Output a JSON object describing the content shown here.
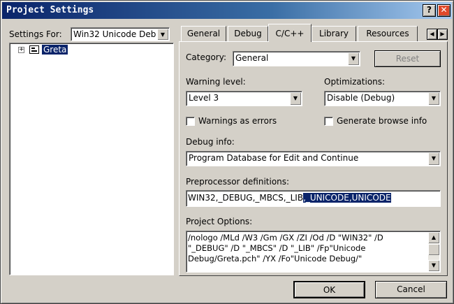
{
  "window": {
    "title": "Project Settings",
    "help_glyph": "?",
    "close_glyph": "✕"
  },
  "left": {
    "settings_for_label": "Settings For:",
    "settings_for_value": "Win32 Unicode Deb",
    "tree": [
      {
        "expander": "+",
        "label": "Greta",
        "selected": true
      }
    ]
  },
  "tabs": [
    {
      "label": "General",
      "active": false
    },
    {
      "label": "Debug",
      "active": false
    },
    {
      "label": "C/C++",
      "active": true
    },
    {
      "label": "Library",
      "active": false
    },
    {
      "label": "Resources",
      "active": false
    }
  ],
  "tab_scroll": {
    "left": "◀",
    "right": "▶"
  },
  "panel": {
    "category_label": "Category:",
    "category_value": "General",
    "reset_label": "Reset",
    "warning_label": "Warning level:",
    "warning_value": "Level 3",
    "optim_label": "Optimizations:",
    "optim_value": "Disable (Debug)",
    "warnings_errors_label": "Warnings as errors",
    "browse_label": "Generate browse info",
    "debuginfo_label": "Debug info:",
    "debuginfo_value": "Program Database for Edit and Continue",
    "preproc_label": "Preprocessor definitions:",
    "preproc_plain": "WIN32,_DEBUG,_MBCS,_LIB",
    "preproc_selected": ",_UNICODE,UNICODE",
    "options_label": "Project Options:",
    "options_lines": [
      "/nologo /MLd /W3 /Gm /GX /ZI /Od /D \"WIN32\" /D",
      "\"_DEBUG\" /D \"_MBCS\" /D \"_LIB\" /Fp\"Unicode",
      "Debug/Greta.pch\" /YX /Fo\"Unicode Debug/\""
    ],
    "scroll_up": "▲",
    "scroll_down": "▼"
  },
  "footer": {
    "ok_label": "OK",
    "cancel_label": "Cancel"
  },
  "colors": {
    "face": "#d4d0c8",
    "title_start": "#0a246a",
    "title_end": "#a6caf0",
    "selection": "#0a246a"
  }
}
